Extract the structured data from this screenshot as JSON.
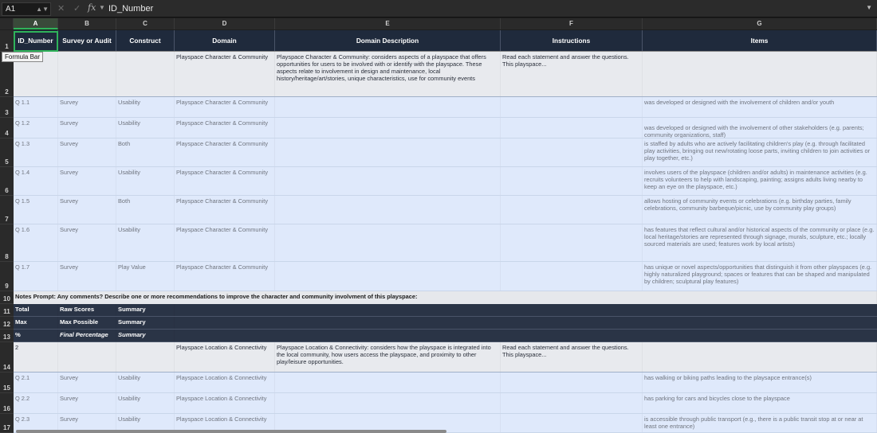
{
  "formula_bar": {
    "name_box": "A1",
    "fx_label": "fx",
    "value": "ID_Number"
  },
  "columns": [
    "A",
    "B",
    "C",
    "D",
    "E",
    "F",
    "G"
  ],
  "rows": [
    "1",
    "2",
    "3",
    "4",
    "5",
    "6",
    "7",
    "8",
    "9",
    "10",
    "11",
    "12",
    "13",
    "14",
    "15",
    "16",
    "17"
  ],
  "header": {
    "a": "ID_Number",
    "b": "Survey or Audit",
    "c": "Construct",
    "d": "Domain",
    "e": "Domain Description",
    "f": "Instructions",
    "g": "Items"
  },
  "tooltip": "Formula Bar",
  "section1": {
    "d": "Playspace Character & Community",
    "e": "Playspace Character & Community: considers aspects of a playspace that offers opportunities for users to be involved with or identify with the playspace. These aspects relate to involvement in design and maintenance, local history/heritage/art/stories, unique characteristics, use for community events",
    "f": "Read each statement and answer the questions. This playspace..."
  },
  "questions1": [
    {
      "a": "Q 1.1",
      "b": "Survey",
      "c": "Usability",
      "d": "Playspace Character & Community",
      "g": "was developed or designed with the involvement of children and/or youth"
    },
    {
      "a": "Q 1.2",
      "b": "Survey",
      "c": "Usability",
      "d": "Playspace Character & Community",
      "g": "was developed or designed with the involvement of other stakeholders (e.g. parents; community organizations, staff)"
    },
    {
      "a": "Q 1.3",
      "b": "Survey",
      "c": "Both",
      "d": "Playspace Character & Community",
      "g": "is staffed by adults who are actively facilitating children's play (e.g. through facilitated play activities, bringing out new/rotating loose parts, inviting children to join activities or play together, etc.)"
    },
    {
      "a": "Q 1.4",
      "b": "Survey",
      "c": "Usability",
      "d": "Playspace Character & Community",
      "g": "involves users  of the playspace (children and/or adults) in maintenance activities (e.g. recruits volunteers to help with landscaping, painting; assigns adults living nearby to keep an eye on the playspace, etc.)"
    },
    {
      "a": "Q 1.5",
      "b": "Survey",
      "c": "Both",
      "d": "Playspace Character & Community",
      "g": "allows hosting of community events or celebrations (e.g. birthday parties, family celebrations, community barbeque/picnic, use by community play groups)"
    },
    {
      "a": "Q 1.6",
      "b": "Survey",
      "c": "Usability",
      "d": "Playspace Character & Community",
      "g": "has features that reflect cultural and/or historical aspects of the community or place (e.g. local heritage/stories are represented through signage, murals, sculpture, etc.; locally sourced materials are used; features work by local artists)"
    },
    {
      "a": "Q 1.7",
      "b": "Survey",
      "c": "Play Value",
      "d": "Playspace Character & Community",
      "g": "has unique or novel aspects/opportunities that distinguish it from other playspaces (e.g. highly naturalized playground; spaces or features that can be shaped and manipulated by children; sculptural play features)"
    }
  ],
  "notes": "Notes Prompt: Any comments? Describe one or more recommendations to improve the character and community involvment of this playspace:",
  "summary": [
    {
      "a": "Total",
      "b": "Raw Scores",
      "c": "Summary"
    },
    {
      "a": "Max",
      "b": "Max Possible",
      "c": "Summary"
    },
    {
      "a": "%",
      "b": "Final Percentage",
      "c": "Summary"
    }
  ],
  "section2": {
    "a": "2",
    "d": "Playspace Location & Connectivity",
    "e": "Playspace Location & Connectivity: considers how the playspace is integrated into the local community, how users access the playspace, and proximity to other play/leisure opportunities.",
    "f": "Read each statement and answer the questions. This playspace..."
  },
  "questions2": [
    {
      "a": "Q 2.1",
      "b": "Survey",
      "c": "Usability",
      "d": "Playspace Location & Connectivity",
      "g": "has walking or biking paths leading to the playsapce entrance(s)"
    },
    {
      "a": "Q 2.2",
      "b": "Survey",
      "c": "Usability",
      "d": "Playspace Location & Connectivity",
      "g": "has parking for cars and bicycles close to the playspace"
    },
    {
      "a": "Q 2.3",
      "b": "Survey",
      "c": "Usability",
      "d": "Playspace Location & Connectivity",
      "g": "is accessible through public transport (e.g., there is a public transit stop at or near at least one entrance)"
    }
  ]
}
